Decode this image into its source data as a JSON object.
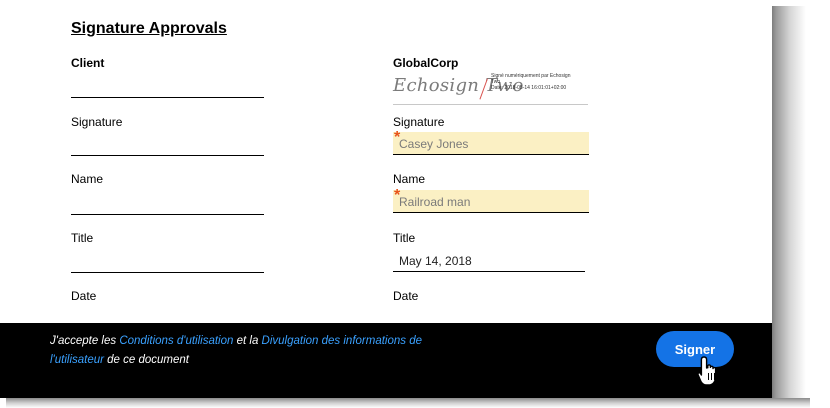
{
  "document": {
    "heading": "Signature Approvals",
    "client": {
      "title": "Client",
      "labels": [
        "Signature",
        "Name",
        "Title",
        "Date"
      ]
    },
    "globalcorp": {
      "title": "GlobalCorp",
      "esignature": {
        "script_text": "Echosign Two",
        "stamp_line1": "Signé numériquement par Echosign",
        "stamp_line2": "Two",
        "stamp_line3": "Date: 2018-05-14 16:01:01+02:00"
      },
      "labels": [
        "Signature",
        "Name",
        "Title",
        "Date"
      ],
      "fields": {
        "name_value": "Casey Jones",
        "title_value": "Railroad man",
        "date_value": "May 14, 2018",
        "required_marker": "*"
      }
    }
  },
  "footer": {
    "consent_prefix": "J'accepte les ",
    "terms_link": "Conditions d'utilisation",
    "consent_middle": " et la ",
    "disclosure_link_part1": "Divulgation des informations de",
    "disclosure_link_part2": "l'utilisateur",
    "consent_suffix": " de ce document",
    "sign_button": "Signer"
  },
  "colors": {
    "accent_button": "#1473e6",
    "link": "#3aa1ff",
    "field_highlight": "#fbf0c4",
    "required_marker": "#e8531b",
    "footer_bg": "#000000"
  },
  "icons": {
    "cursor": "hand-pointer-icon"
  }
}
